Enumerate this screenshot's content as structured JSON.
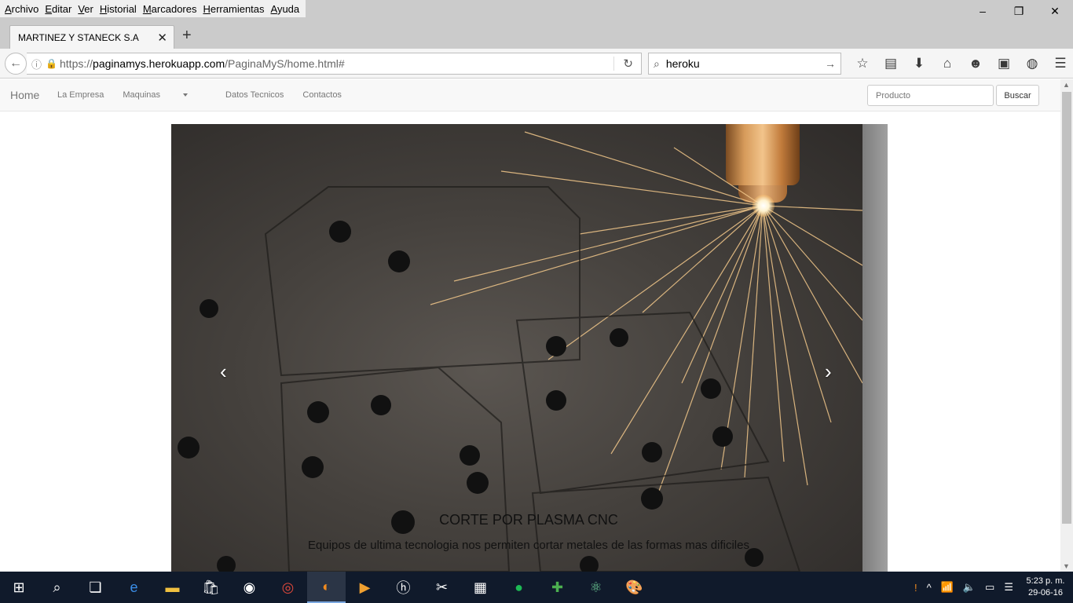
{
  "menubar": {
    "items": [
      "Archivo",
      "Editar",
      "Ver",
      "Historial",
      "Marcadores",
      "Herramientas",
      "Ayuda"
    ]
  },
  "window_controls": {
    "minimize": "–",
    "restore": "❐",
    "close": "✕"
  },
  "tab": {
    "title": "MARTINEZ Y STANECK S.A",
    "close": "✕",
    "new_tab": "+"
  },
  "address": {
    "scheme": "https://",
    "domain": "paginamys.herokuapp.com",
    "path": "/PaginaMyS/home.html#"
  },
  "search": {
    "value": "heroku"
  },
  "site_nav": {
    "brand": "Home",
    "links": [
      "La Empresa",
      "Maquinas",
      "Datos Tecnicos",
      "Contactos"
    ],
    "search_placeholder": "Producto",
    "search_button": "Buscar"
  },
  "carousel": {
    "prev": "‹",
    "next": "›",
    "caption_title": "CORTE POR PLASMA CNC",
    "caption_text": "Equipos de ultima tecnologia nos permiten cortar metales de las formas mas dificiles"
  },
  "taskbar": {
    "clock_time": "5:23 p. m.",
    "clock_date": "29-06-16"
  }
}
